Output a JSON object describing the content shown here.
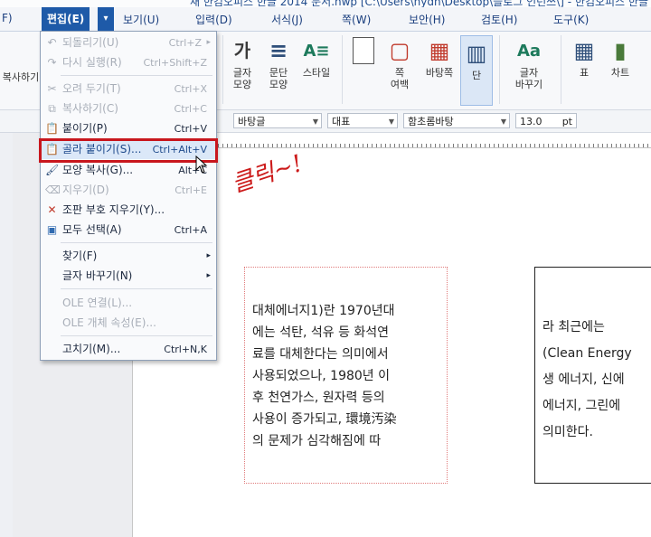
{
  "window": {
    "title": "새 한컴오피스 한글 2014 문서.hwp [C:\\Users\\hydn\\Desktop\\블로그 인턴쓰\\] - 한컴오피스 한글"
  },
  "menubar": {
    "left_fragment": "F)",
    "items": [
      {
        "label": "편집(E)"
      },
      {
        "label": "보기(U)"
      },
      {
        "label": "입력(D)"
      },
      {
        "label": "서식(J)"
      },
      {
        "label": "쪽(W)"
      },
      {
        "label": "보안(H)"
      },
      {
        "label": "검토(H)"
      },
      {
        "label": "도구(K)"
      }
    ],
    "chevron": "▾"
  },
  "ribbon": {
    "left_label": "복사하기",
    "buttons": [
      {
        "label": "글자\n모양",
        "icon": "가"
      },
      {
        "label": "문단\n모양",
        "icon": "≡"
      },
      {
        "label": "스타일",
        "icon": "A≡"
      },
      {
        "label": "쪽\n여백",
        "icon": "▢"
      },
      {
        "label": "바탕쪽",
        "icon": "▦"
      },
      {
        "label": "단",
        "icon": "▥"
      },
      {
        "label": "글자\n바꾸기",
        "icon": "Aa"
      },
      {
        "label": "표",
        "icon": "▦"
      },
      {
        "label": "차트",
        "icon": "▮"
      }
    ]
  },
  "format_toolbar": {
    "style": "바탕글",
    "lang": "대표",
    "font": "함초롬바탕",
    "size": "13.0",
    "unit": "pt"
  },
  "edit_menu": {
    "items": [
      {
        "label": "되돌리기(U)",
        "shortcut": "Ctrl+Z",
        "enabled": false,
        "submenu": true,
        "icon": "undo-icon"
      },
      {
        "label": "다시 실행(R)",
        "shortcut": "Ctrl+Shift+Z",
        "enabled": false,
        "icon": "redo-icon"
      },
      {
        "label": "오려 두기(T)",
        "shortcut": "Ctrl+X",
        "enabled": false,
        "icon": "cut-icon"
      },
      {
        "label": "복사하기(C)",
        "shortcut": "Ctrl+C",
        "enabled": false,
        "icon": "copy-icon"
      },
      {
        "label": "붙이기(P)",
        "shortcut": "Ctrl+V",
        "enabled": true,
        "icon": "paste-icon"
      },
      {
        "label": "골라 붙이기(S)...",
        "shortcut": "Ctrl+Alt+V",
        "enabled": true,
        "highlighted": true,
        "icon": "paste-special-icon"
      },
      {
        "label": "모양 복사(G)...",
        "shortcut": "Alt+C",
        "enabled": true,
        "icon": "format-painter-icon"
      },
      {
        "label": "지우기(D)",
        "shortcut": "Ctrl+E",
        "enabled": false,
        "icon": "eraser-icon"
      },
      {
        "label": "조판 부호 지우기(Y)...",
        "shortcut": "",
        "enabled": true,
        "icon": "clear-marks-icon"
      },
      {
        "label": "모두 선택(A)",
        "shortcut": "Ctrl+A",
        "enabled": true,
        "icon": "select-all-icon"
      },
      {
        "label": "찾기(F)",
        "shortcut": "",
        "enabled": true,
        "submenu": true
      },
      {
        "label": "글자 바꾸기(N)",
        "shortcut": "",
        "enabled": true,
        "submenu": true
      },
      {
        "label": "OLE 연결(L)...",
        "shortcut": "",
        "enabled": false
      },
      {
        "label": "OLE 개체 속성(E)...",
        "shortcut": "",
        "enabled": false
      },
      {
        "label": "고치기(M)...",
        "shortcut": "Ctrl+N,K",
        "enabled": true
      }
    ]
  },
  "annotation": "클릭~!",
  "document": {
    "para1_lines": [
      "대체에너지1)란   1970년대",
      "에는 석탄, 석유 등 화석연",
      "료를 대체한다는 의미에서",
      "사용되었으나,  1980년  이",
      "후 천연가스, 원자력 등의",
      "사용이 증가되고, 環境汚染",
      "의 문제가 심각해짐에 따"
    ],
    "para2_lines": [
      "라   최근에는",
      "(Clean Energy",
      "생 에너지, 신에",
      "에너지,  그린에",
      "의미한다."
    ]
  }
}
